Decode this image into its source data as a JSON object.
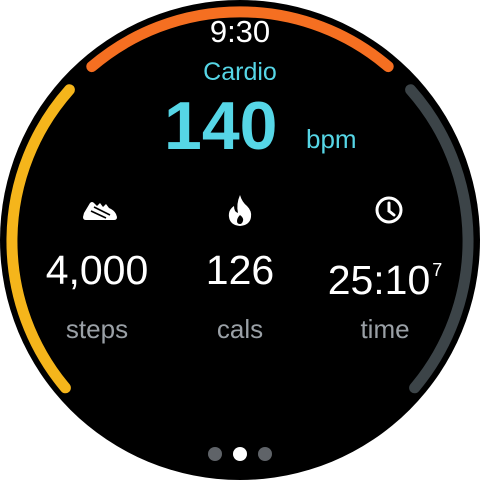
{
  "status": {
    "time": "9:30"
  },
  "workout": {
    "type": "Cardio",
    "heart_rate": "140",
    "heart_rate_unit": "bpm"
  },
  "stats": [
    {
      "icon": "shoe-icon",
      "value": "4,000",
      "value_sup": "",
      "label": "steps"
    },
    {
      "icon": "flame-icon",
      "value": "126",
      "value_sup": "",
      "label": "cals"
    },
    {
      "icon": "clock-icon",
      "value": "25:10",
      "value_sup": "7",
      "label": "time"
    }
  ],
  "pager": {
    "page_count": 3,
    "active_page": 2
  },
  "colors": {
    "accent": "#56d6e6",
    "zone_arc_left": "#f5b51b",
    "zone_arc_top": "#f56f21",
    "zone_arc_right": "#3c4448",
    "secondary_text": "#9aa0a6"
  }
}
